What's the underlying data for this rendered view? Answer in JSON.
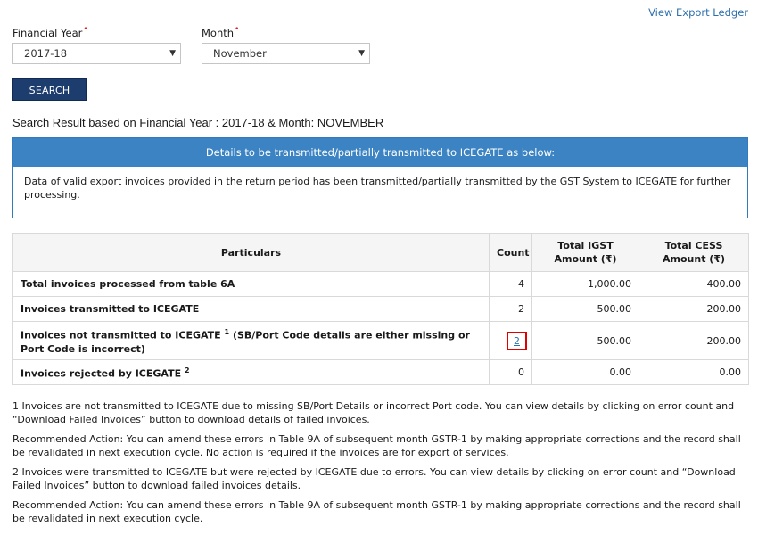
{
  "header": {
    "view_export_ledger": "View Export Ledger"
  },
  "filters": {
    "financial_year": {
      "label": "Financial Year",
      "value": "2017-18"
    },
    "month": {
      "label": "Month",
      "value": "November"
    },
    "required_mark": "•",
    "search_button": "SEARCH"
  },
  "result_title": "Search Result based on Financial Year : 2017-18 & Month: NOVEMBER",
  "panel": {
    "heading": "Details to be transmitted/partially transmitted to ICEGATE as below:",
    "body": "Data of valid export invoices provided in the return period has been transmitted/partially transmitted by the GST System to ICEGATE for further processing."
  },
  "table": {
    "headers": {
      "particulars": "Particulars",
      "count": "Count",
      "igst": "Total IGST Amount (₹)",
      "cess": "Total CESS Amount (₹)"
    },
    "rows": [
      {
        "particulars": "Total invoices processed from table 6A",
        "count": "4",
        "igst": "1,000.00",
        "cess": "400.00"
      },
      {
        "particulars": "Invoices transmitted to ICEGATE",
        "count": "2",
        "igst": "500.00",
        "cess": "200.00"
      },
      {
        "particulars_a": "Invoices not transmitted to ICEGATE",
        "sup": "1",
        "particulars_b": " (SB/Port Code details are either missing or Port Code is incorrect)",
        "count": "2",
        "igst": "500.00",
        "cess": "200.00"
      },
      {
        "particulars": "Invoices rejected by ICEGATE",
        "sup": "2",
        "count": "0",
        "igst": "0.00",
        "cess": "0.00"
      }
    ]
  },
  "notes": [
    "1 Invoices are not transmitted to ICEGATE due to missing SB/Port Details or incorrect Port code. You can view details by clicking on error count and “Download Failed Invoices” button to download details of failed invoices.",
    "Recommended Action: You can amend these errors in Table 9A of subsequent month GSTR-1 by making appropriate corrections and the record shall be revalidated in next execution cycle. No action is required if the invoices are for export of services.",
    "2 Invoices were transmitted to ICEGATE but were rejected by ICEGATE due to errors. You can view details by clicking on error count and “Download Failed Invoices” button to download failed invoices details.",
    "Recommended Action: You can amend these errors in Table 9A of subsequent month GSTR-1 by making appropriate corrections and the record shall be revalidated in next execution cycle."
  ],
  "colors": {
    "brand_navy": "#1c3d6e",
    "panel_blue": "#3b83c2",
    "link_blue": "#2c6fad",
    "required_red": "#e0201b",
    "highlight_red": "#e00000"
  }
}
